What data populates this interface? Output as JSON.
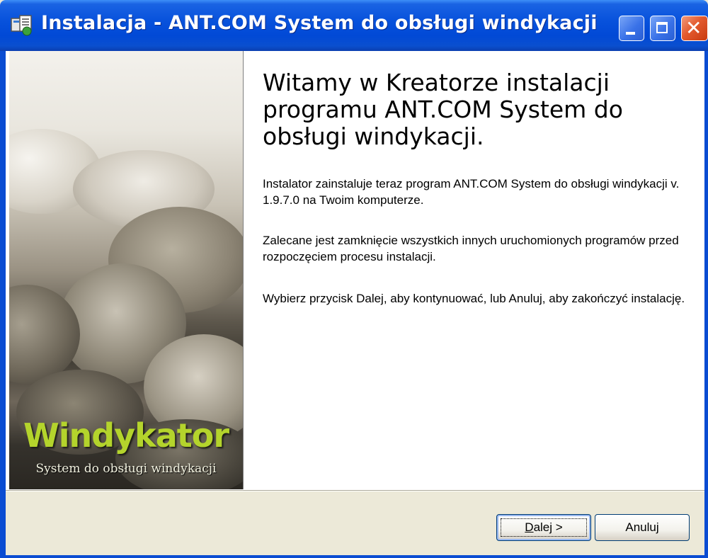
{
  "window": {
    "title": "Instalacja - ANT.COM System do obsługi windykacji",
    "icon": "installer-icon",
    "controls": [
      "minimize-icon",
      "maximize-icon",
      "close-icon"
    ]
  },
  "banner": {
    "title": "Windykator",
    "subtitle": "System do obsługi windykacji"
  },
  "welcome": {
    "title": "Witamy w Kreatorze instalacji programu ANT.COM System do obsługi windykacji.",
    "paragraphs": [
      "Instalator zainstaluje teraz program ANT.COM System do obsługi windykacji v. 1.9.7.0 na Twoim komputerze.",
      "Zalecane jest zamknięcie wszystkich innych uruchomionych programów przed rozpoczęciem procesu instalacji.",
      "Wybierz przycisk Dalej, aby kontynuować, lub Anuluj, aby zakończyć instalację."
    ]
  },
  "buttons": {
    "next_accel": "D",
    "next_rest": "alej >",
    "cancel": "Anuluj"
  },
  "colors": {
    "titlebar": "#0149d6",
    "banner_title": "#b4d42c",
    "face": "#ece9d8"
  }
}
